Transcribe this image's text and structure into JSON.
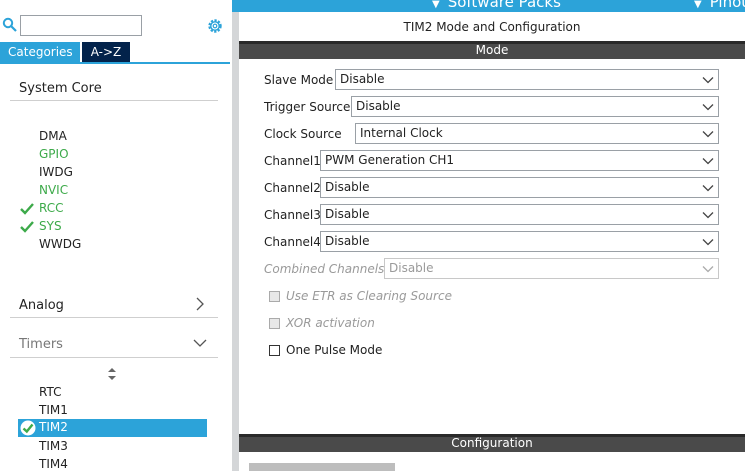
{
  "topbar": {
    "menus": [
      "Software Packs",
      "Pinout"
    ]
  },
  "left": {
    "search": {
      "value": "",
      "placeholder": ""
    },
    "tabs": {
      "categories": "Categories",
      "az": "A->Z"
    },
    "system_core": {
      "title": "System Core",
      "items": [
        {
          "label": "DMA",
          "status": "none"
        },
        {
          "label": "GPIO",
          "status": "green"
        },
        {
          "label": "IWDG",
          "status": "none"
        },
        {
          "label": "NVIC",
          "status": "green"
        },
        {
          "label": "RCC",
          "status": "checked"
        },
        {
          "label": "SYS",
          "status": "checked"
        },
        {
          "label": "WWDG",
          "status": "none"
        }
      ]
    },
    "analog": {
      "title": "Analog"
    },
    "timers": {
      "title": "Timers",
      "items": [
        {
          "label": "RTC"
        },
        {
          "label": "TIM1"
        },
        {
          "label": "TIM2",
          "selected": true
        },
        {
          "label": "TIM3"
        },
        {
          "label": "TIM4"
        }
      ]
    }
  },
  "right": {
    "title": "TIM2 Mode and Configuration",
    "mode_header": "Mode",
    "fields": [
      {
        "label": "Slave Mode",
        "value": "Disable"
      },
      {
        "label": "Trigger Source",
        "value": "Disable"
      },
      {
        "label": "Clock Source",
        "value": "Internal Clock"
      },
      {
        "label": "Channel1",
        "value": "PWM Generation CH1"
      },
      {
        "label": "Channel2",
        "value": "Disable"
      },
      {
        "label": "Channel3",
        "value": "Disable"
      },
      {
        "label": "Channel4",
        "value": "Disable"
      },
      {
        "label": "Combined Channels",
        "value": "Disable",
        "disabled": true
      }
    ],
    "checkboxes": [
      {
        "label": "Use ETR as Clearing Source",
        "checked": false,
        "disabled": true
      },
      {
        "label": "XOR activation",
        "checked": false,
        "disabled": true
      },
      {
        "label": "One Pulse Mode",
        "checked": false,
        "disabled": false
      }
    ],
    "config_header": "Configuration"
  },
  "colors": {
    "accent": "#2ca3d9",
    "dark_tab": "#03234b",
    "section_bar": "#4a4a4a",
    "enabled_green": "#3daa4a"
  }
}
